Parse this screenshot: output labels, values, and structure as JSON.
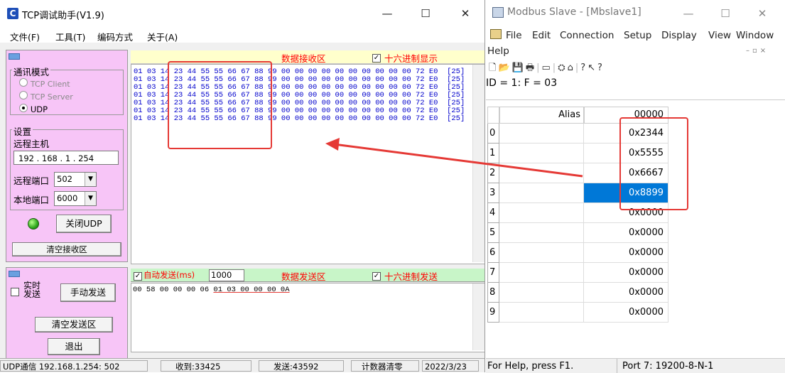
{
  "tcp": {
    "title": "TCP调试助手(V1.9)",
    "app_icon": "C",
    "menu": [
      "文件(F)",
      "工具(T)",
      "编码方式",
      "关于(A)"
    ],
    "comm_mode": {
      "title": "通讯模式",
      "options": [
        {
          "label": "TCP Client",
          "selected": false
        },
        {
          "label": "TCP Server",
          "selected": false
        },
        {
          "label": "UDP",
          "selected": true
        }
      ]
    },
    "settings": {
      "title": "设置",
      "remote_host_label": "远程主机",
      "remote_host_value": "192 . 168 .  1  . 254",
      "remote_port_label": "远程端口",
      "remote_port_value": "502",
      "local_port_label": "本地端口",
      "local_port_value": "6000"
    },
    "close_udp_button": "关闭UDP",
    "clear_recv_button": "清空接收区",
    "receive": {
      "title": "数据接收区",
      "hex_display_label": "十六进制显示",
      "hex_display_checked": true,
      "lines": [
        "01 03 14 23 44 55 55 66 67 88 99 00 00 00 00 00 00 00 00 00 00 72 E0  [25]",
        "01 03 14 23 44 55 55 66 67 88 99 00 00 00 00 00 00 00 00 00 00 72 E0  [25]",
        "01 03 14 23 44 55 55 66 67 88 99 00 00 00 00 00 00 00 00 00 00 72 E0  [25]",
        "01 03 14 23 44 55 55 66 67 88 99 00 00 00 00 00 00 00 00 00 00 72 E0  [25]",
        "01 03 14 23 44 55 55 66 67 88 99 00 00 00 00 00 00 00 00 00 00 72 E0  [25]",
        "01 03 14 23 44 55 55 66 67 88 99 00 00 00 00 00 00 00 00 00 00 72 E0  [25]",
        "01 03 14 23 44 55 55 66 67 88 99 00 00 00 00 00 00 00 00 00 00 72 E0  [25]"
      ]
    },
    "send": {
      "auto_send_label": "自动发送(ms)",
      "auto_send_checked": true,
      "interval_value": "1000",
      "title": "数据发送区",
      "hex_send_label": "十六进制发送",
      "hex_send_checked": true,
      "content_prefix": "00 58 00 00 00 06 ",
      "content_underlined": "01 03 00 00 00 0A"
    },
    "realtime_send_label": "实时发送",
    "manual_send_button": "手动发送",
    "clear_send_button": "清空发送区",
    "exit_button": "退出",
    "status": {
      "conn": "UDP通信 192.168.1.254:  502",
      "received": "收到:33425",
      "sent": "发送:43592",
      "reset_counter": "计数器清零",
      "date": "2022/3/23"
    }
  },
  "modbus": {
    "title": "Modbus Slave - [Mbslave1]",
    "menu": [
      "File",
      "Edit",
      "Connection",
      "Setup",
      "Display",
      "View",
      "Window",
      "Help"
    ],
    "id_line": "ID = 1: F = 03",
    "col_alias": "Alias",
    "col_value": "00000",
    "rows": [
      {
        "index": "0",
        "value": "0x2344"
      },
      {
        "index": "1",
        "value": "0x5555"
      },
      {
        "index": "2",
        "value": "0x6667"
      },
      {
        "index": "3",
        "value": "0x8899"
      },
      {
        "index": "4",
        "value": "0x0000"
      },
      {
        "index": "5",
        "value": "0x0000"
      },
      {
        "index": "6",
        "value": "0x0000"
      },
      {
        "index": "7",
        "value": "0x0000"
      },
      {
        "index": "8",
        "value": "0x0000"
      },
      {
        "index": "9",
        "value": "0x0000"
      }
    ],
    "selected_row": 3,
    "status_help": "For Help, press F1.",
    "status_port": "Port 7: 19200-8-N-1"
  },
  "colors": {
    "annotation_red": "#e53935",
    "selection_blue": "#0078d7",
    "panel_pink": "#f7c5f7",
    "recv_text": "#0000cc"
  }
}
